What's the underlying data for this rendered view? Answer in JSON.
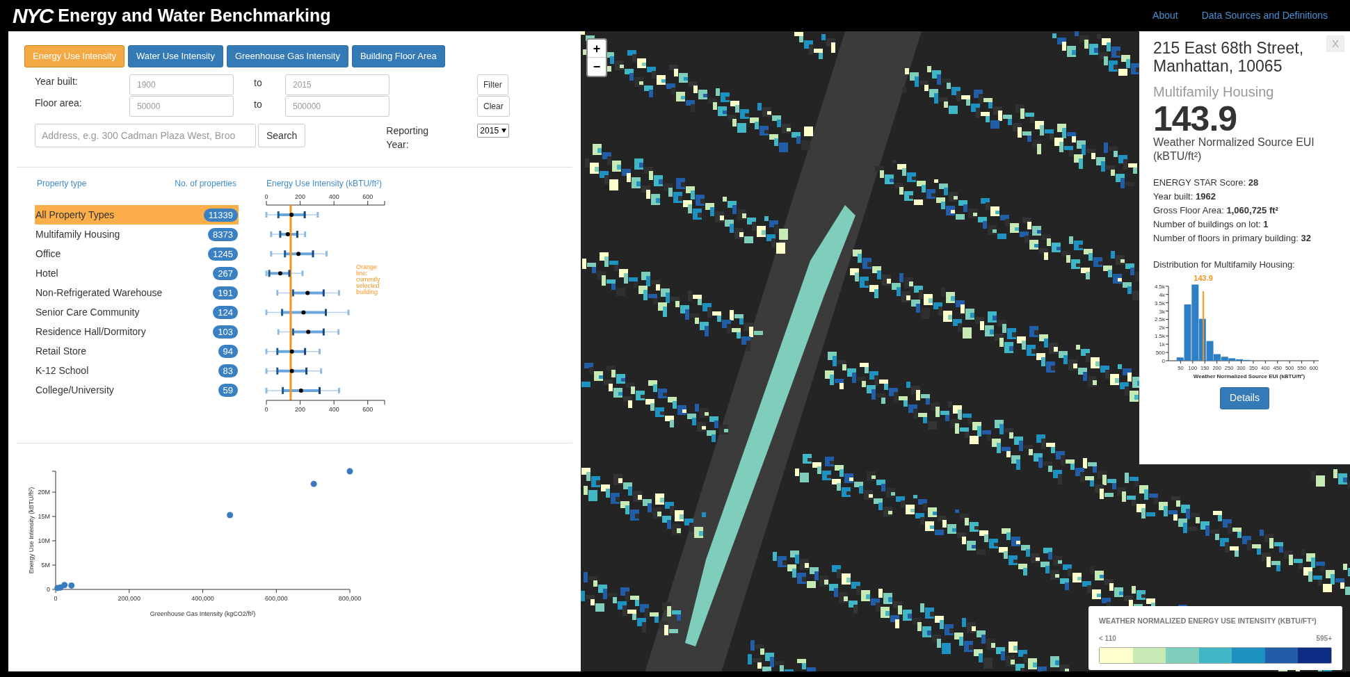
{
  "header": {
    "logo": "NYC",
    "title": "Energy and Water Benchmarking",
    "links": [
      "About",
      "Data Sources and Definitions"
    ]
  },
  "metric_tabs": [
    {
      "label": "Energy Use Intensity",
      "selected": true
    },
    {
      "label": "Water Use Intensity",
      "selected": false
    },
    {
      "label": "Greenhouse Gas Intensity",
      "selected": false
    },
    {
      "label": "Building Floor Area",
      "selected": false
    }
  ],
  "filters": {
    "rows": [
      {
        "label": "Year built:",
        "from_placeholder": "1900",
        "to_label": "to",
        "to_placeholder": "2015",
        "button": "Filter"
      },
      {
        "label": "Floor area:",
        "from_placeholder": "50000",
        "to_label": "to",
        "to_placeholder": "500000",
        "button": "Clear"
      }
    ],
    "search": {
      "placeholder": "Address, e.g. 300 Cadman Plaza West, Broo",
      "button": "Search"
    },
    "reporting_year": {
      "label": "Reporting Year:",
      "value": "2015"
    }
  },
  "property_table": {
    "columns": [
      "Property type",
      "No. of properties",
      "Energy Use Intensity (kBTU/ft²)"
    ],
    "rows": [
      {
        "name": "All Property Types",
        "count": "11339",
        "selected": true
      },
      {
        "name": "Multifamily Housing",
        "count": "8373",
        "selected": false
      },
      {
        "name": "Office",
        "count": "1245",
        "selected": false
      },
      {
        "name": "Hotel",
        "count": "267",
        "selected": false
      },
      {
        "name": "Non-Refrigerated Warehouse",
        "count": "191",
        "selected": false
      },
      {
        "name": "Senior Care Community",
        "count": "124",
        "selected": false
      },
      {
        "name": "Residence Hall/Dormitory",
        "count": "103",
        "selected": false
      },
      {
        "name": "Retail Store",
        "count": "94",
        "selected": false
      },
      {
        "name": "K-12 School",
        "count": "83",
        "selected": false
      },
      {
        "name": "College/University",
        "count": "59",
        "selected": false
      }
    ],
    "chart_data": {
      "type": "scatter",
      "orientation": "horizontal",
      "series": [
        {
          "color": "#8fbbe3",
          "values": [
            0,
            28,
            28,
            0,
            65,
            0,
            71,
            0,
            0,
            0
          ]
        },
        {
          "color": "#1d5a96",
          "values": [
            71,
            82,
            110,
            17,
            158,
            93,
            158,
            65,
            65,
            97
          ]
        },
        {
          "color": "#000000",
          "values": [
            149,
            127,
            190,
            82,
            244,
            220,
            248,
            151,
            151,
            205
          ]
        },
        {
          "color": "#17467a",
          "values": [
            227,
            183,
            276,
            136,
            339,
            352,
            339,
            229,
            237,
            315
          ]
        },
        {
          "color": "#8fbbe3",
          "values": [
            304,
            229,
            356,
            214,
            430,
            486,
            427,
            315,
            324,
            430
          ]
        }
      ],
      "xlim": [
        0,
        700
      ],
      "xticks": [
        0,
        200,
        400,
        600
      ],
      "ref_lines": [
        {
          "axis": "x",
          "value": 143.9,
          "color": "#f7941d"
        }
      ]
    },
    "bottom_axis_labels": [
      "0",
      "200",
      "400",
      "600"
    ],
    "note": "Orange line: currently selected building"
  },
  "scatter": {
    "chart_data": {
      "type": "scatter",
      "xlabel": "Greenhouse Gas Intensity (kgCO2/ft²)",
      "ylabel": "Energy Use Intensity (kBTU/ft²)",
      "x": [
        800000,
        702000,
        474000,
        43000,
        24000,
        13000,
        5000
      ],
      "series": [
        {
          "color": "#3a7bbf",
          "values": [
            24300000,
            21700000,
            15300000,
            800000,
            900000,
            400000,
            300000
          ]
        }
      ],
      "xlim": [
        0,
        800000
      ],
      "ylim": [
        0,
        24300000
      ],
      "xticks": [
        {
          "value": 0,
          "label": "0"
        },
        {
          "value": 200000,
          "label": "200,000"
        },
        {
          "value": 400000,
          "label": "400,000"
        },
        {
          "value": 600000,
          "label": "600,000"
        },
        {
          "value": 800000,
          "label": "800,000"
        }
      ],
      "yticks": [
        {
          "value": 0,
          "label": "0"
        },
        {
          "value": 5000000,
          "label": "5M"
        },
        {
          "value": 10000000,
          "label": "10M"
        },
        {
          "value": 15000000,
          "label": "15M"
        },
        {
          "value": 20000000,
          "label": "20M"
        }
      ]
    }
  },
  "map_controls": {
    "zoom_in": "+",
    "zoom_out": "−"
  },
  "building_panel": {
    "close": "X",
    "address": "215 East 68th Street, Manhattan, 10065",
    "type": "Multifamily Housing",
    "value": "143.9",
    "metric": "Weather Normalized Source EUI (kBTU/ft²)",
    "facts": [
      {
        "label": "ENERGY STAR Score:",
        "value": "28"
      },
      {
        "label": "Year built:",
        "value": "1962"
      },
      {
        "label": "Gross Floor Area:",
        "value": "1,060,725 ft²"
      },
      {
        "label": "Number of buildings on lot:",
        "value": "1"
      },
      {
        "label": "Number of floors in primary building:",
        "value": "32"
      }
    ],
    "distribution_title": "Distribution for Multifamily Housing:",
    "chart_data": {
      "type": "bar",
      "xlabel": "Weather Normalized Source EUI (kBTU/ft²)",
      "x": [
        48,
        79,
        110,
        140,
        171,
        201,
        232,
        262,
        293,
        323
      ],
      "series": [
        {
          "color": "#2f7fc4",
          "values": [
            200,
            3400,
            4600,
            2530,
            1190,
            400,
            240,
            150,
            90,
            50
          ]
        }
      ],
      "xlim": [
        0,
        620
      ],
      "ylim": [
        0,
        4700
      ],
      "xticks": [
        50,
        100,
        150,
        200,
        250,
        300,
        350,
        400,
        450,
        500,
        550,
        600
      ],
      "yticks": [
        {
          "value": 0,
          "label": "0"
        },
        {
          "value": 500,
          "label": "500"
        },
        {
          "value": 1000,
          "label": "1k"
        },
        {
          "value": 1500,
          "label": "1.5k"
        },
        {
          "value": 2000,
          "label": "2k"
        },
        {
          "value": 2500,
          "label": "2.5k"
        },
        {
          "value": 3000,
          "label": "3k"
        },
        {
          "value": 3500,
          "label": "3.5k"
        },
        {
          "value": 4000,
          "label": "4k"
        },
        {
          "value": 4500,
          "label": "4.5k"
        }
      ],
      "ref_lines": [
        {
          "axis": "x",
          "value": 143.9,
          "color": "#f7941d"
        }
      ],
      "annotations": [
        "143.9"
      ]
    },
    "button": "Details"
  },
  "legend": {
    "title": "WEATHER NORMALIZED ENERGY USE INTENSITY (KBTU/FT²)",
    "min_label": "< 110",
    "max_label": "595+",
    "bins": [
      {
        "color": "#ffffcc"
      },
      {
        "color": "#c7e9b4"
      },
      {
        "color": "#7fcdbb"
      },
      {
        "color": "#41b6c4"
      },
      {
        "color": "#1d91c0"
      },
      {
        "color": "#225ea8"
      },
      {
        "color": "#0c2c84"
      }
    ]
  }
}
